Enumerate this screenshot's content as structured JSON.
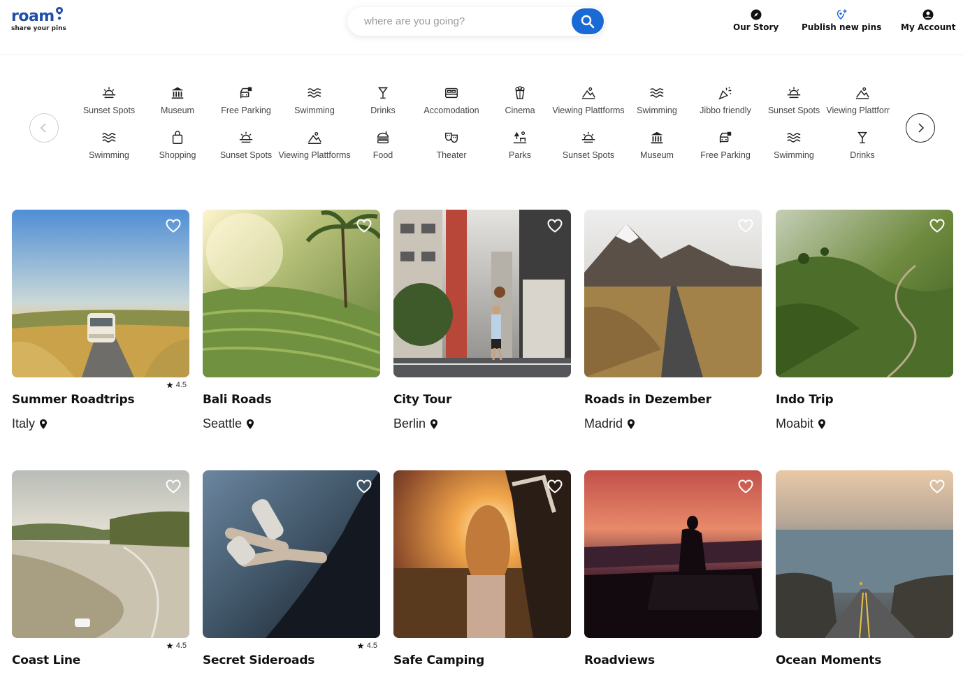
{
  "brand": {
    "name": "roam",
    "tagline": "share your pins",
    "accent": "#1a6ad6",
    "logo_color": "#1f4fa8"
  },
  "search": {
    "placeholder": "where are you going?",
    "value": "",
    "button_icon": "search-icon"
  },
  "nav": [
    {
      "label": "Our Story",
      "icon": "compass-icon"
    },
    {
      "label": "Publish new pins",
      "icon": "pin-plus-icon"
    },
    {
      "label": "My Account",
      "icon": "user-icon"
    }
  ],
  "categories": {
    "row1": [
      {
        "label": "Sunset Spots",
        "icon": "sunset-icon"
      },
      {
        "label": "Museum",
        "icon": "museum-icon"
      },
      {
        "label": "Free Parking",
        "icon": "parking-icon"
      },
      {
        "label": "Swimming",
        "icon": "waves-icon"
      },
      {
        "label": "Drinks",
        "icon": "cocktail-icon"
      },
      {
        "label": "Accomodation",
        "icon": "bed-icon"
      },
      {
        "label": "Cinema",
        "icon": "popcorn-icon"
      },
      {
        "label": "Viewing Plattforms",
        "icon": "landscape-icon"
      },
      {
        "label": "Swimming",
        "icon": "waves-icon"
      },
      {
        "label": "Jibbo friendly",
        "icon": "party-icon"
      },
      {
        "label": "Sunset Spots",
        "icon": "sunset-icon"
      },
      {
        "label": "Viewing Plattforms",
        "icon": "landscape-icon"
      }
    ],
    "row2": [
      {
        "label": "Swimming",
        "icon": "waves-icon"
      },
      {
        "label": "Shopping",
        "icon": "bag-icon"
      },
      {
        "label": "Sunset Spots",
        "icon": "sunset-icon"
      },
      {
        "label": "Viewing Plattforms",
        "icon": "landscape-icon"
      },
      {
        "label": "Food",
        "icon": "burger-icon"
      },
      {
        "label": "Theater",
        "icon": "masks-icon"
      },
      {
        "label": "Parks",
        "icon": "park-icon"
      },
      {
        "label": "Sunset Spots",
        "icon": "sunset-icon"
      },
      {
        "label": "Museum",
        "icon": "museum-icon"
      },
      {
        "label": "Free Parking",
        "icon": "parking-icon"
      },
      {
        "label": "Swimming",
        "icon": "waves-icon"
      },
      {
        "label": "Drinks",
        "icon": "cocktail-icon"
      }
    ]
  },
  "cards": [
    {
      "title": "Summer Roadtrips",
      "location": "Italy",
      "rating": "4.5",
      "scene": "van-road"
    },
    {
      "title": "Bali Roads",
      "location": "Seattle",
      "rating": "",
      "scene": "rice-terrace"
    },
    {
      "title": "City Tour",
      "location": "Berlin",
      "rating": "",
      "scene": "city"
    },
    {
      "title": "Roads in Dezember",
      "location": "Madrid",
      "rating": "",
      "scene": "mountain-road"
    },
    {
      "title": "Indo Trip",
      "location": "Moabit",
      "rating": "",
      "scene": "green-hills"
    },
    {
      "title": "Coast Line",
      "location": "",
      "rating": "4.5",
      "scene": "coast"
    },
    {
      "title": "Secret Sideroads",
      "location": "",
      "rating": "4.5",
      "scene": "car-feet"
    },
    {
      "title": "Safe Camping",
      "location": "",
      "rating": "",
      "scene": "sunset-girl"
    },
    {
      "title": "Roadviews",
      "location": "",
      "rating": "",
      "scene": "dusk-sit"
    },
    {
      "title": "Ocean Moments",
      "location": "",
      "rating": "",
      "scene": "ocean-road"
    }
  ]
}
